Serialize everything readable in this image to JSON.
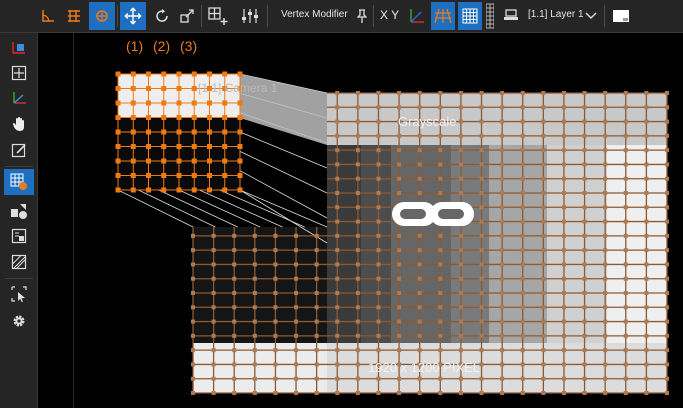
{
  "toolbar": {
    "mode_label": "Vertex Modifier",
    "axes_label": "X Y",
    "layer_label": "[1.1] Layer 1"
  },
  "numbered_tabs": [
    "(1)",
    "(2)",
    "(3)"
  ],
  "canvas": {
    "camera_label": "[1.1] Camera 1",
    "grayscale_label": "Grayscale",
    "resolution_label": "1920 x 1200 PIXEL"
  },
  "colors": {
    "accent_blue": "#1f6fc0",
    "vertex_orange": "#f07a12",
    "panel_bg": "#252525"
  }
}
